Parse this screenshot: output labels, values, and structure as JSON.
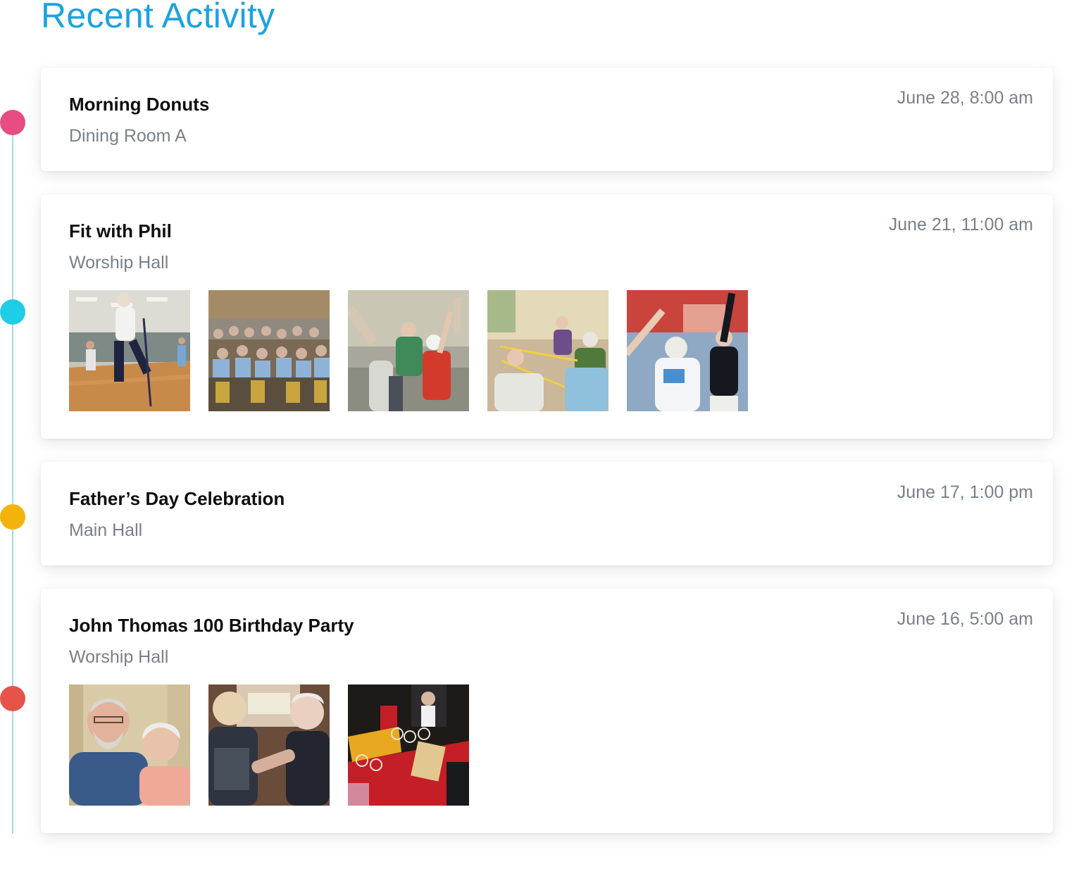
{
  "page": {
    "title": "Recent Activity"
  },
  "colors": {
    "title_accent": "#1ba3e0",
    "timeline_line": "#a9d6e4",
    "dot_1": "#e74c82",
    "dot_2": "#1ecde6",
    "dot_3": "#f4b30a",
    "dot_4": "#e5534b"
  },
  "activities": [
    {
      "title": "Morning Donuts",
      "location": "Dining Room A",
      "date": "June 28, 8:00 am",
      "photos": []
    },
    {
      "title": "Fit with Phil",
      "location": "Worship Hall",
      "date": "June 21, 11:00 am",
      "photos": [
        "photo of senior woman exercising with walking poles in gym",
        "photo of seniors seated in chairs holding booklets",
        "photo of seniors raising arms in exercise class",
        "photo of seniors stretching resistance bands while seated",
        "photo of senior women stretching arms overhead"
      ]
    },
    {
      "title": "Father’s Day Celebration",
      "location": "Main Hall",
      "date": "June 17, 1:00 pm",
      "photos": []
    },
    {
      "title": "John Thomas 100 Birthday Party",
      "location": "Worship Hall",
      "date": "June 16, 5:00 am",
      "photos": [
        "photo of smiling bearded man with elderly woman",
        "photo of elderly couple dancing",
        "photo of party table with red tablecloth and 100 decoration"
      ]
    }
  ]
}
